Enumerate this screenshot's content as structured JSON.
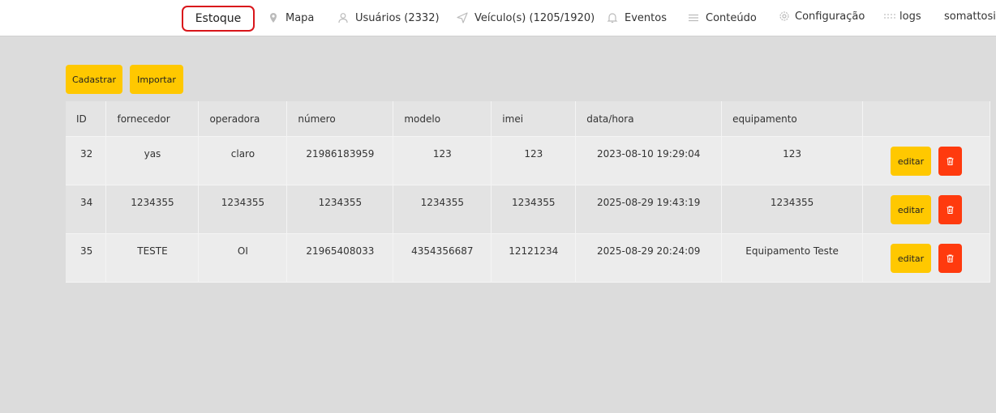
{
  "nav": {
    "active": "Estoque",
    "items": [
      {
        "label": "Mapa",
        "icon": "map-pin-icon"
      },
      {
        "label": "Usuários (2332)",
        "icon": "user-icon"
      },
      {
        "label": "Veículo(s) (1205/1920)",
        "icon": "send-icon"
      },
      {
        "label": "Eventos",
        "icon": "bell-icon"
      },
      {
        "label": "Conteúdo",
        "icon": "menu-icon"
      },
      {
        "label": "Configuração",
        "icon": "gear-icon"
      },
      {
        "label": "logs",
        "icon": "grid-dots-icon"
      },
      {
        "label": "somattosir"
      }
    ]
  },
  "toolbar": {
    "register_label": "Cadastrar",
    "import_label": "Importar"
  },
  "table": {
    "headers": [
      "ID",
      "fornecedor",
      "operadora",
      "número",
      "modelo",
      "imei",
      "data/hora",
      "equipamento",
      ""
    ],
    "rows": [
      {
        "id": "32",
        "fornecedor": "yas",
        "operadora": "claro",
        "numero": "21986183959",
        "modelo": "123",
        "imei": "123",
        "datahora": "2023-08-10 19:29:04",
        "equipamento": "123"
      },
      {
        "id": "34",
        "fornecedor": "1234355",
        "operadora": "1234355",
        "numero": "1234355",
        "modelo": "1234355",
        "imei": "1234355",
        "datahora": "2025-08-29 19:43:19",
        "equipamento": "1234355"
      },
      {
        "id": "35",
        "fornecedor": "TESTE",
        "operadora": "OI",
        "numero": "21965408033",
        "modelo": "4354356687",
        "imei": "12121234",
        "datahora": "2025-08-29 20:24:09",
        "equipamento": "Equipamento Teste"
      }
    ],
    "edit_label": "editar",
    "delete_icon": "trash-icon"
  },
  "colors": {
    "accent": "#ffc800",
    "danger": "#ff3a0e",
    "active_border": "#d9161b"
  }
}
